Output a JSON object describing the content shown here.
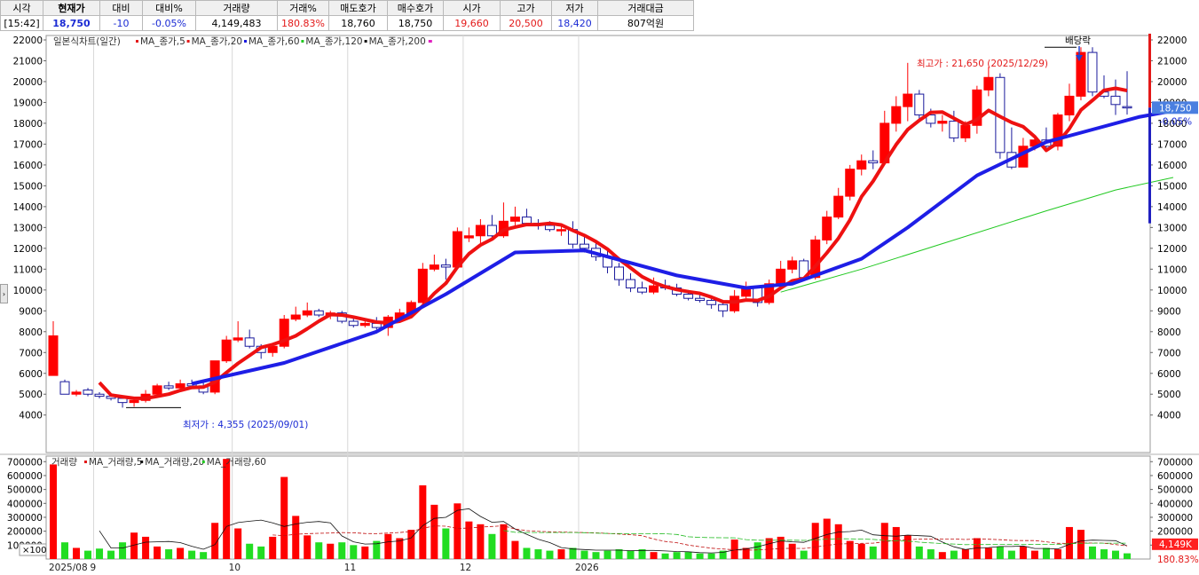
{
  "quote": {
    "headers": [
      "시각",
      "현재가",
      "대비",
      "대비%",
      "거래량",
      "거래%",
      "매도호가",
      "매수호가",
      "시가",
      "고가",
      "저가",
      "거래대금"
    ],
    "values": [
      "[15:42]",
      "18,750",
      "-10",
      "-0.05%",
      "4,149,483",
      "180.83%",
      "18,760",
      "18,750",
      "19,660",
      "20,500",
      "18,420",
      "807억원"
    ]
  },
  "price_panel": {
    "legend_title": "일본식차트(일간)",
    "ma_labels": [
      "MA_종가,5",
      "MA_종가,20",
      "MA_종가,60",
      "MA_종가,120",
      "MA_종가,200"
    ],
    "ma_colors": [
      "#e31919",
      "#e31919",
      "#1a1ae0",
      "#22c922",
      "#111111"
    ],
    "high_annotation": "최고가 : 21,650 (2025/12/29)",
    "low_annotation": "최저가 : 4,355 (2025/09/01)",
    "dividend_label": "배당락",
    "last_price_label": "18,750",
    "last_change_label": "-0.05%"
  },
  "volume_panel": {
    "legend_title": "거래량",
    "ma_labels": [
      "MA_거래량,5",
      "MA_거래량,20",
      "MA_거래량,60"
    ],
    "ma_colors": [
      "#e31919",
      "#111111",
      "#22c922"
    ],
    "last_volume_label": "4,149K",
    "last_ratio_label": "180.83%",
    "scale_badge": "×100"
  },
  "colors": {
    "up": "#ff0000",
    "down_outline": "#1a1a9c",
    "vol_up": "#ff0000",
    "vol_down": "#22dd22",
    "ma60": "#1e1ee6",
    "ma5": "#ee1111"
  },
  "x_axis_labels": [
    "2025/08",
    "9",
    "10",
    "11",
    "12",
    "2026"
  ],
  "chart_data": {
    "type": "candlestick",
    "price_axis": {
      "min": 4000,
      "max": 22000,
      "step": 1000
    },
    "volume_axis": {
      "min": 0,
      "max": 700000,
      "step": 100000
    },
    "month_starts": [
      {
        "label": "2025/08",
        "index": 0
      },
      {
        "label": "9",
        "index": 4
      },
      {
        "label": "10",
        "index": 16
      },
      {
        "label": "11",
        "index": 26
      },
      {
        "label": "12",
        "index": 36
      },
      {
        "label": "2026",
        "index": 46
      }
    ],
    "candles": [
      {
        "o": 5900,
        "h": 8500,
        "l": 5900,
        "c": 7800,
        "v": 680000
      },
      {
        "o": 5600,
        "h": 5700,
        "l": 5000,
        "c": 5000,
        "v": 120000
      },
      {
        "o": 5000,
        "h": 5200,
        "l": 4900,
        "c": 5100,
        "v": 80000
      },
      {
        "o": 5200,
        "h": 5300,
        "l": 4900,
        "c": 5000,
        "v": 60000
      },
      {
        "o": 5000,
        "h": 5100,
        "l": 4800,
        "c": 4900,
        "v": 75000
      },
      {
        "o": 4900,
        "h": 5000,
        "l": 4700,
        "c": 4800,
        "v": 60000
      },
      {
        "o": 4800,
        "h": 4900,
        "l": 4355,
        "c": 4600,
        "v": 120000
      },
      {
        "o": 4600,
        "h": 4800,
        "l": 4400,
        "c": 4700,
        "v": 190000
      },
      {
        "o": 4700,
        "h": 5200,
        "l": 4600,
        "c": 5000,
        "v": 160000
      },
      {
        "o": 5000,
        "h": 5500,
        "l": 4900,
        "c": 5400,
        "v": 90000
      },
      {
        "o": 5400,
        "h": 5600,
        "l": 5200,
        "c": 5300,
        "v": 70000
      },
      {
        "o": 5300,
        "h": 5700,
        "l": 5200,
        "c": 5500,
        "v": 80000
      },
      {
        "o": 5500,
        "h": 5700,
        "l": 5300,
        "c": 5400,
        "v": 60000
      },
      {
        "o": 5400,
        "h": 5600,
        "l": 5000,
        "c": 5100,
        "v": 50000
      },
      {
        "o": 5100,
        "h": 6600,
        "l": 5000,
        "c": 6600,
        "v": 260000
      },
      {
        "o": 6600,
        "h": 7800,
        "l": 6500,
        "c": 7600,
        "v": 720000
      },
      {
        "o": 7600,
        "h": 8500,
        "l": 7500,
        "c": 7700,
        "v": 220000
      },
      {
        "o": 7700,
        "h": 8100,
        "l": 7200,
        "c": 7300,
        "v": 110000
      },
      {
        "o": 7300,
        "h": 7400,
        "l": 6700,
        "c": 7000,
        "v": 90000
      },
      {
        "o": 7000,
        "h": 7400,
        "l": 6800,
        "c": 7300,
        "v": 160000
      },
      {
        "o": 7300,
        "h": 8800,
        "l": 7200,
        "c": 8600,
        "v": 590000
      },
      {
        "o": 8600,
        "h": 9200,
        "l": 8500,
        "c": 8800,
        "v": 310000
      },
      {
        "o": 8800,
        "h": 9400,
        "l": 8700,
        "c": 9000,
        "v": 170000
      },
      {
        "o": 9000,
        "h": 9100,
        "l": 8700,
        "c": 8800,
        "v": 120000
      },
      {
        "o": 8800,
        "h": 9000,
        "l": 8600,
        "c": 8900,
        "v": 110000
      },
      {
        "o": 8900,
        "h": 9000,
        "l": 8400,
        "c": 8500,
        "v": 120000
      },
      {
        "o": 8500,
        "h": 8700,
        "l": 8200,
        "c": 8300,
        "v": 100000
      },
      {
        "o": 8300,
        "h": 8600,
        "l": 8200,
        "c": 8400,
        "v": 90000
      },
      {
        "o": 8400,
        "h": 8700,
        "l": 8100,
        "c": 8200,
        "v": 130000
      },
      {
        "o": 8200,
        "h": 8800,
        "l": 7800,
        "c": 8700,
        "v": 180000
      },
      {
        "o": 8600,
        "h": 9100,
        "l": 8500,
        "c": 8900,
        "v": 150000
      },
      {
        "o": 8900,
        "h": 9500,
        "l": 8800,
        "c": 9400,
        "v": 210000
      },
      {
        "o": 9400,
        "h": 11300,
        "l": 9300,
        "c": 11000,
        "v": 530000
      },
      {
        "o": 11000,
        "h": 11700,
        "l": 10900,
        "c": 11200,
        "v": 390000
      },
      {
        "o": 11200,
        "h": 11500,
        "l": 10500,
        "c": 11100,
        "v": 220000
      },
      {
        "o": 11100,
        "h": 13000,
        "l": 11000,
        "c": 12800,
        "v": 400000
      },
      {
        "o": 12500,
        "h": 13000,
        "l": 12300,
        "c": 12600,
        "v": 270000
      },
      {
        "o": 12600,
        "h": 13400,
        "l": 12200,
        "c": 13100,
        "v": 250000
      },
      {
        "o": 13100,
        "h": 13600,
        "l": 12400,
        "c": 12600,
        "v": 180000
      },
      {
        "o": 12600,
        "h": 14200,
        "l": 12500,
        "c": 13300,
        "v": 250000
      },
      {
        "o": 13300,
        "h": 14000,
        "l": 13100,
        "c": 13500,
        "v": 130000
      },
      {
        "o": 13500,
        "h": 13900,
        "l": 13100,
        "c": 13200,
        "v": 80000
      },
      {
        "o": 13200,
        "h": 13400,
        "l": 12900,
        "c": 13100,
        "v": 70000
      },
      {
        "o": 13100,
        "h": 13300,
        "l": 12800,
        "c": 12900,
        "v": 60000
      },
      {
        "o": 12900,
        "h": 13100,
        "l": 12600,
        "c": 12900,
        "v": 70000
      },
      {
        "o": 12900,
        "h": 13300,
        "l": 12000,
        "c": 12200,
        "v": 80000
      },
      {
        "o": 12200,
        "h": 12600,
        "l": 11800,
        "c": 12000,
        "v": 60000
      },
      {
        "o": 12000,
        "h": 12300,
        "l": 11400,
        "c": 11600,
        "v": 50000
      },
      {
        "o": 11600,
        "h": 12000,
        "l": 10800,
        "c": 11100,
        "v": 60000
      },
      {
        "o": 11100,
        "h": 11300,
        "l": 10200,
        "c": 10500,
        "v": 70000
      },
      {
        "o": 10500,
        "h": 10800,
        "l": 9900,
        "c": 10100,
        "v": 60000
      },
      {
        "o": 10100,
        "h": 10400,
        "l": 9800,
        "c": 9900,
        "v": 70000
      },
      {
        "o": 9900,
        "h": 10600,
        "l": 9800,
        "c": 10200,
        "v": 50000
      },
      {
        "o": 10200,
        "h": 10500,
        "l": 10000,
        "c": 10100,
        "v": 40000
      },
      {
        "o": 10100,
        "h": 10300,
        "l": 9700,
        "c": 9800,
        "v": 50000
      },
      {
        "o": 9800,
        "h": 10000,
        "l": 9500,
        "c": 9600,
        "v": 50000
      },
      {
        "o": 9600,
        "h": 9800,
        "l": 9400,
        "c": 9500,
        "v": 40000
      },
      {
        "o": 9500,
        "h": 9700,
        "l": 9100,
        "c": 9300,
        "v": 40000
      },
      {
        "o": 9300,
        "h": 9500,
        "l": 8700,
        "c": 9000,
        "v": 60000
      },
      {
        "o": 9000,
        "h": 10000,
        "l": 8900,
        "c": 9700,
        "v": 140000
      },
      {
        "o": 9700,
        "h": 10400,
        "l": 9600,
        "c": 10100,
        "v": 80000
      },
      {
        "o": 10100,
        "h": 10200,
        "l": 9200,
        "c": 9400,
        "v": 120000
      },
      {
        "o": 9400,
        "h": 10500,
        "l": 9300,
        "c": 10300,
        "v": 150000
      },
      {
        "o": 10300,
        "h": 11400,
        "l": 10200,
        "c": 11000,
        "v": 160000
      },
      {
        "o": 11000,
        "h": 11600,
        "l": 10800,
        "c": 11400,
        "v": 110000
      },
      {
        "o": 11400,
        "h": 11500,
        "l": 10500,
        "c": 10600,
        "v": 60000
      },
      {
        "o": 10600,
        "h": 12600,
        "l": 10500,
        "c": 12400,
        "v": 260000
      },
      {
        "o": 12400,
        "h": 13800,
        "l": 12200,
        "c": 13500,
        "v": 290000
      },
      {
        "o": 13500,
        "h": 14900,
        "l": 13400,
        "c": 14500,
        "v": 250000
      },
      {
        "o": 14500,
        "h": 16000,
        "l": 14300,
        "c": 15800,
        "v": 130000
      },
      {
        "o": 15800,
        "h": 16500,
        "l": 15500,
        "c": 16200,
        "v": 110000
      },
      {
        "o": 16200,
        "h": 16700,
        "l": 15800,
        "c": 16100,
        "v": 90000
      },
      {
        "o": 16100,
        "h": 18600,
        "l": 16000,
        "c": 18000,
        "v": 260000
      },
      {
        "o": 18000,
        "h": 19300,
        "l": 17600,
        "c": 18800,
        "v": 230000
      },
      {
        "o": 18800,
        "h": 20900,
        "l": 18100,
        "c": 19400,
        "v": 170000
      },
      {
        "o": 19400,
        "h": 19600,
        "l": 18100,
        "c": 18400,
        "v": 90000
      },
      {
        "o": 18400,
        "h": 18700,
        "l": 17800,
        "c": 18000,
        "v": 70000
      },
      {
        "o": 18000,
        "h": 18400,
        "l": 17600,
        "c": 18100,
        "v": 50000
      },
      {
        "o": 18100,
        "h": 18600,
        "l": 17100,
        "c": 17300,
        "v": 60000
      },
      {
        "o": 17300,
        "h": 18100,
        "l": 17100,
        "c": 17900,
        "v": 70000
      },
      {
        "o": 17900,
        "h": 19800,
        "l": 17500,
        "c": 19600,
        "v": 150000
      },
      {
        "o": 19600,
        "h": 20700,
        "l": 19300,
        "c": 20200,
        "v": 80000
      },
      {
        "o": 20200,
        "h": 20400,
        "l": 16300,
        "c": 16600,
        "v": 90000
      },
      {
        "o": 16600,
        "h": 17800,
        "l": 15800,
        "c": 15900,
        "v": 60000
      },
      {
        "o": 15900,
        "h": 17300,
        "l": 15900,
        "c": 16900,
        "v": 90000
      },
      {
        "o": 16900,
        "h": 17400,
        "l": 16700,
        "c": 17200,
        "v": 60000
      },
      {
        "o": 17200,
        "h": 17800,
        "l": 16700,
        "c": 16900,
        "v": 80000
      },
      {
        "o": 16900,
        "h": 18500,
        "l": 16700,
        "c": 18400,
        "v": 70000
      },
      {
        "o": 18400,
        "h": 19900,
        "l": 18100,
        "c": 19300,
        "v": 230000
      },
      {
        "o": 19300,
        "h": 21650,
        "l": 19100,
        "c": 21400,
        "v": 210000
      },
      {
        "o": 21400,
        "h": 21650,
        "l": 19300,
        "c": 19500,
        "v": 90000
      },
      {
        "o": 19500,
        "h": 20300,
        "l": 19200,
        "c": 19300,
        "v": 70000
      },
      {
        "o": 19300,
        "h": 20100,
        "l": 18400,
        "c": 18900,
        "v": 60000
      },
      {
        "o": 18800,
        "h": 20500,
        "l": 18420,
        "c": 18750,
        "v": 41000
      }
    ],
    "ma60": [
      {
        "i": 12,
        "v": 5500
      },
      {
        "i": 20,
        "v": 6500
      },
      {
        "i": 28,
        "v": 8000
      },
      {
        "i": 34,
        "v": 9800
      },
      {
        "i": 40,
        "v": 11800
      },
      {
        "i": 46,
        "v": 11900
      },
      {
        "i": 54,
        "v": 10700
      },
      {
        "i": 60,
        "v": 10100
      },
      {
        "i": 64,
        "v": 10300
      },
      {
        "i": 70,
        "v": 11500
      },
      {
        "i": 74,
        "v": 13000
      },
      {
        "i": 80,
        "v": 15500
      },
      {
        "i": 86,
        "v": 17100
      },
      {
        "i": 90,
        "v": 17700
      },
      {
        "i": 94,
        "v": 18300
      },
      {
        "i": 97,
        "v": 18600
      }
    ],
    "ma120": [
      {
        "i": 63,
        "v": 9900
      },
      {
        "i": 70,
        "v": 11000
      },
      {
        "i": 78,
        "v": 12400
      },
      {
        "i": 86,
        "v": 13800
      },
      {
        "i": 92,
        "v": 14800
      },
      {
        "i": 97,
        "v": 15400
      }
    ]
  }
}
